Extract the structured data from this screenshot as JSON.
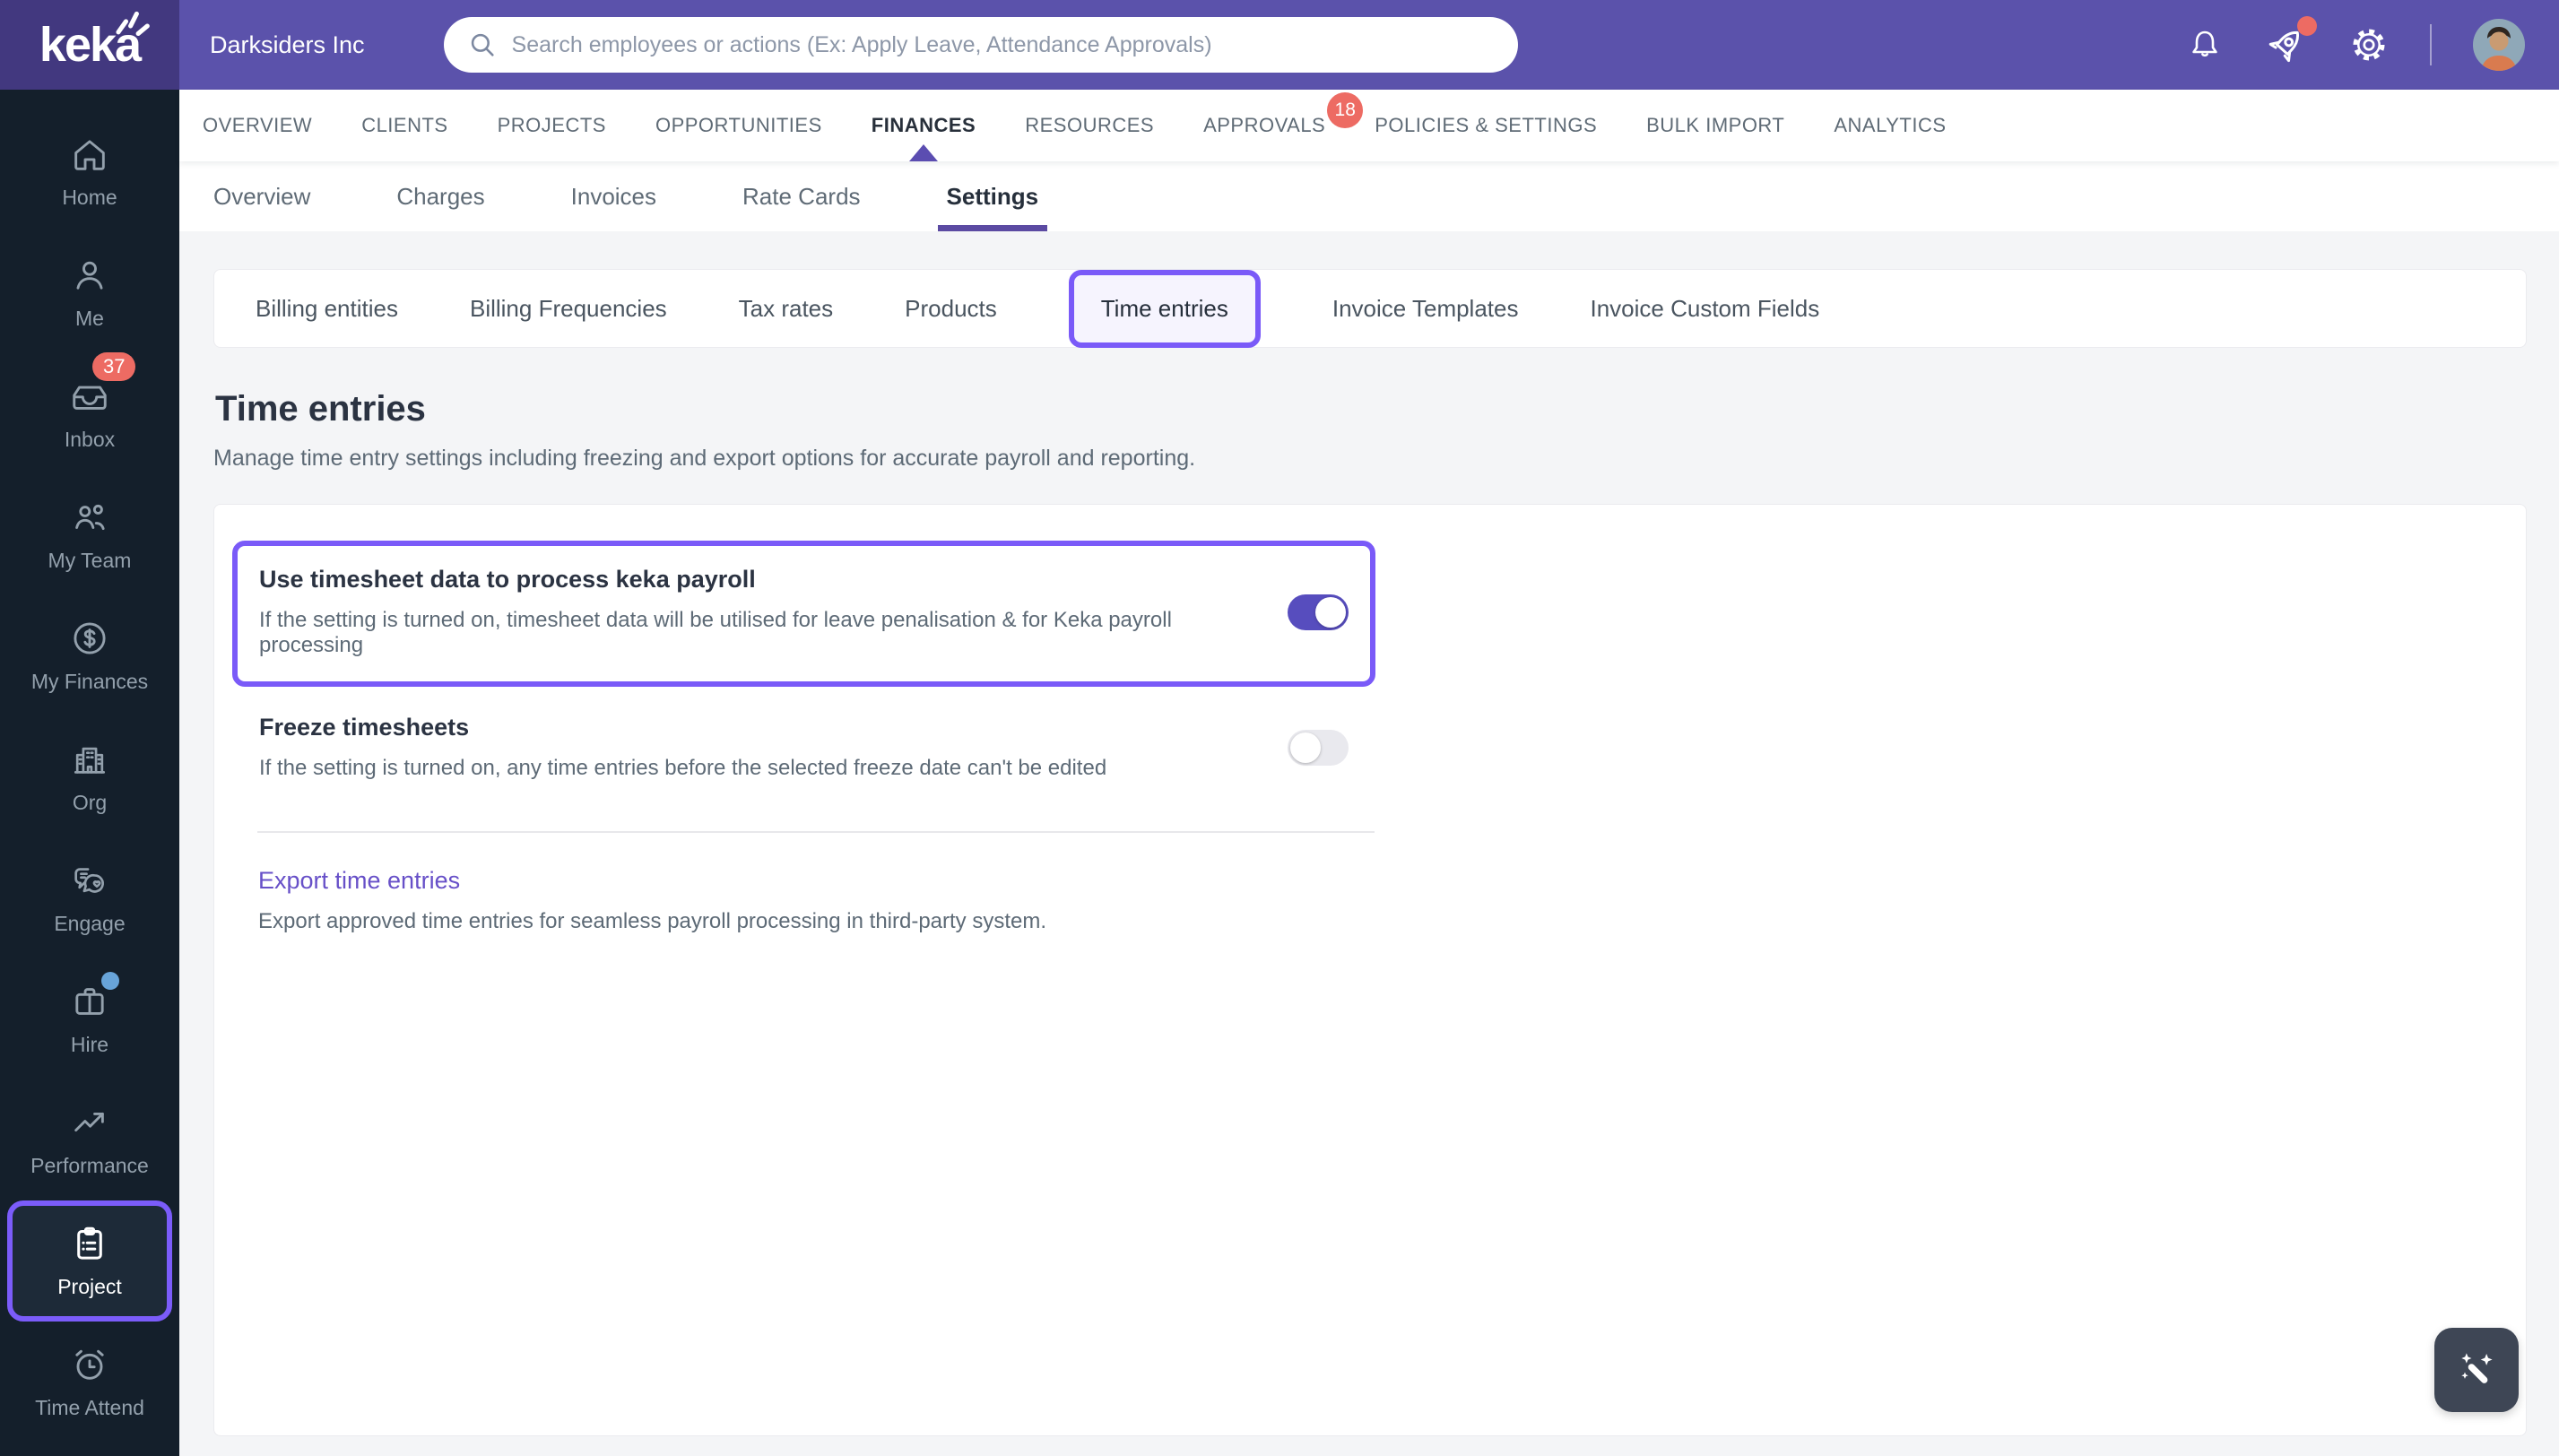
{
  "brand": {
    "logo": "keka",
    "company": "Darksiders Inc"
  },
  "topbar": {
    "search_placeholder": "Search employees or actions (Ex: Apply Leave, Attendance Approvals)",
    "rocket_has_alert_dot": true
  },
  "main_nav": {
    "items": [
      {
        "label": "OVERVIEW"
      },
      {
        "label": "CLIENTS"
      },
      {
        "label": "PROJECTS"
      },
      {
        "label": "OPPORTUNITIES"
      },
      {
        "label": "FINANCES",
        "active": true
      },
      {
        "label": "RESOURCES"
      },
      {
        "label": "APPROVALS",
        "badge": "18"
      },
      {
        "label": "POLICIES & SETTINGS"
      },
      {
        "label": "BULK IMPORT"
      },
      {
        "label": "ANALYTICS"
      }
    ]
  },
  "sub_nav": {
    "items": [
      {
        "label": "Overview"
      },
      {
        "label": "Charges"
      },
      {
        "label": "Invoices"
      },
      {
        "label": "Rate Cards"
      },
      {
        "label": "Settings",
        "active": true
      }
    ]
  },
  "settings_tabs": {
    "items": [
      {
        "label": "Billing entities"
      },
      {
        "label": "Billing Frequencies"
      },
      {
        "label": "Tax rates"
      },
      {
        "label": "Products"
      },
      {
        "label": "Time entries",
        "active": true
      },
      {
        "label": "Invoice Templates"
      },
      {
        "label": "Invoice Custom Fields"
      }
    ]
  },
  "page": {
    "title": "Time entries",
    "subtitle": "Manage time entry settings including freezing and export options for accurate payroll and reporting."
  },
  "settings": {
    "use_timesheet": {
      "title": "Use timesheet data to process keka payroll",
      "description": "If the setting is turned on, timesheet data will be utilised for leave penalisation & for Keka payroll processing",
      "enabled": true,
      "highlighted": true
    },
    "freeze_timesheets": {
      "title": "Freeze timesheets",
      "description": "If the setting is turned on, any time entries before the selected freeze date can't be edited",
      "enabled": false
    },
    "export": {
      "link": "Export time entries",
      "description": "Export approved time entries for seamless payroll processing in third-party system."
    }
  },
  "sidebar": {
    "items": [
      {
        "label": "Home"
      },
      {
        "label": "Me"
      },
      {
        "label": "Inbox",
        "badge": "37"
      },
      {
        "label": "My Team"
      },
      {
        "label": "My Finances"
      },
      {
        "label": "Org"
      },
      {
        "label": "Engage"
      },
      {
        "label": "Hire",
        "dot": true
      },
      {
        "label": "Performance"
      },
      {
        "label": "Project",
        "active": true
      },
      {
        "label": "Time Attend"
      }
    ]
  },
  "colors": {
    "header_purple": "#5B52AB",
    "logo_purple": "#42387F",
    "sidebar_dark": "#141F2B",
    "accent_purple": "#7A5AF8",
    "nav_indicator_purple": "#5B4DB1",
    "toggle_on_purple": "#574DBE",
    "badge_red": "#ED6B63",
    "link_purple": "#6750C8",
    "hire_dot_blue": "#68A4D9",
    "page_bg": "#F4F5F7"
  }
}
